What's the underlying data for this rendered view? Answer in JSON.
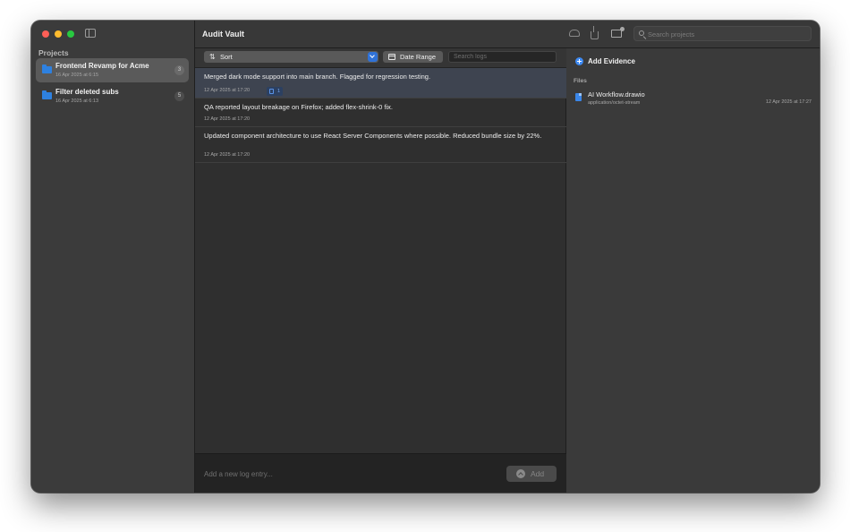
{
  "app": {
    "title": "Audit Vault"
  },
  "sidebar": {
    "section_title": "Projects",
    "projects": [
      {
        "name": "Frontend Revamp for Acme",
        "date": "16 Apr 2025 at 6:15",
        "count": "3",
        "selected": true
      },
      {
        "name": "Filter deleted subs",
        "date": "16 Apr 2025 at 6:13",
        "count": "5",
        "selected": false
      }
    ]
  },
  "toolbar": {
    "sort_label": "Sort",
    "date_range_label": "Date Range",
    "search_placeholder": "Search logs"
  },
  "logs": [
    {
      "text": "Merged dark mode support into main branch. Flagged for regression testing.",
      "date": "12 Apr 2025 at 17:20",
      "attachments": "1",
      "selected": true
    },
    {
      "text": "QA reported layout breakage on Firefox; added flex-shrink-0 fix.",
      "date": "12 Apr 2025 at 17:20",
      "selected": false
    },
    {
      "text": "Updated component architecture to use React Server Components where possible. Reduced bundle size by 22%.",
      "date": "12 Apr 2025 at 17:20",
      "selected": false
    }
  ],
  "composer": {
    "placeholder": "Add a new log entry...",
    "add_label": "Add"
  },
  "header_right": {
    "search_placeholder": "Search projects"
  },
  "evidence": {
    "add_label": "Add Evidence",
    "files_title": "Files",
    "files": [
      {
        "name": "AI Workflow.drawio",
        "type": "application/octet-stream",
        "date": "12 Apr 2025 at 17:27"
      }
    ]
  },
  "colors": {
    "accent": "#2f72d8",
    "folder": "#2e81e0",
    "close": "#fe5f57",
    "minimize": "#febc2e",
    "zoom": "#28c840"
  },
  "icons": [
    "sidebar-toggle-icon",
    "folder-icon",
    "sort-icon",
    "chevron-down-icon",
    "calendar-icon",
    "document-icon",
    "arrow-up-icon",
    "cloud-icon",
    "share-icon",
    "archive-icon",
    "search-icon",
    "plus-icon",
    "file-icon"
  ]
}
